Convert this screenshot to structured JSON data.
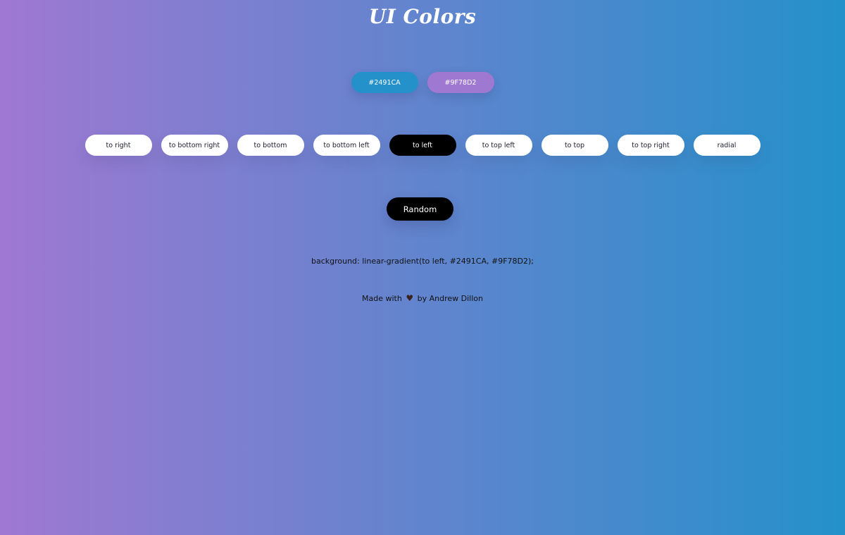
{
  "page": {
    "title": "UI Colors"
  },
  "colors": {
    "color1": {
      "label": "#2491CA",
      "hex": "#2491CA"
    },
    "color2": {
      "label": "#9F78D2",
      "hex": "#9F78D2"
    }
  },
  "directions": {
    "items": [
      {
        "label": "to right",
        "active": false
      },
      {
        "label": "to bottom right",
        "active": false
      },
      {
        "label": "to bottom",
        "active": false
      },
      {
        "label": "to bottom left",
        "active": false
      },
      {
        "label": "to left",
        "active": true
      },
      {
        "label": "to top left",
        "active": false
      },
      {
        "label": "to top",
        "active": false
      },
      {
        "label": "to top right",
        "active": false
      },
      {
        "label": "radial",
        "active": false
      }
    ]
  },
  "random_button": {
    "label": "Random"
  },
  "output": {
    "css_text": "background: linear-gradient(to left, #2491CA, #9F78D2);"
  },
  "footer": {
    "prefix": "Made with",
    "heart_icon": "heart-icon",
    "heart_glyph": "♥",
    "suffix": "by Andrew Dillon"
  }
}
